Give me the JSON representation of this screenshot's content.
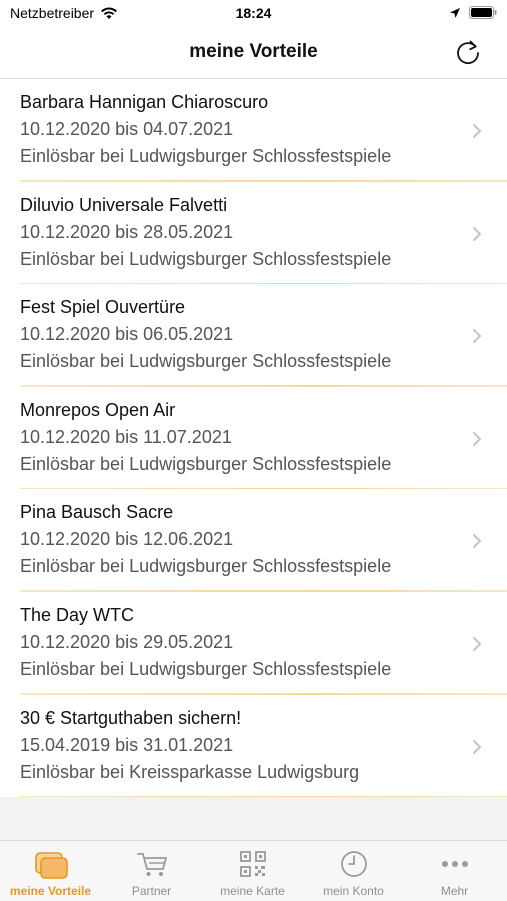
{
  "status_bar": {
    "carrier": "Netzbetreiber",
    "time": "18:24"
  },
  "header": {
    "title": "meine Vorteile"
  },
  "colors": {
    "accent": "#e39a1c",
    "separator": "#f2d99b",
    "inactive": "#8e8e8e"
  },
  "items": [
    {
      "title": "Barbara Hannigan Chiaroscuro",
      "dates": "10.12.2020 bis 04.07.2021",
      "redeem": "Einlösbar bei Ludwigsburger Schlossfestspiele"
    },
    {
      "title": "Diluvio Universale Falvetti",
      "dates": "10.12.2020 bis 28.05.2021",
      "redeem": "Einlösbar bei Ludwigsburger Schlossfestspiele"
    },
    {
      "title": "Fest Spiel Ouvertüre",
      "dates": "10.12.2020 bis 06.05.2021",
      "redeem": "Einlösbar bei Ludwigsburger Schlossfestspiele"
    },
    {
      "title": "Monrepos Open Air",
      "dates": "10.12.2020 bis 11.07.2021",
      "redeem": "Einlösbar bei Ludwigsburger Schlossfestspiele"
    },
    {
      "title": "Pina Bausch Sacre",
      "dates": "10.12.2020 bis 12.06.2021",
      "redeem": "Einlösbar bei Ludwigsburger Schlossfestspiele"
    },
    {
      "title": "The Day WTC",
      "dates": "10.12.2020 bis 29.05.2021",
      "redeem": "Einlösbar bei Ludwigsburger Schlossfestspiele"
    },
    {
      "title": "30 € Startguthaben sichern!",
      "dates": "15.04.2019 bis 31.01.2021",
      "redeem": "Einlösbar bei Kreissparkasse Ludwigsburg"
    }
  ],
  "tabs": [
    {
      "label": "meine Vorteile",
      "icon": "cards-icon",
      "active": true
    },
    {
      "label": "Partner",
      "icon": "cart-icon",
      "active": false
    },
    {
      "label": "meine Karte",
      "icon": "qr-code-icon",
      "active": false
    },
    {
      "label": "mein Konto",
      "icon": "clock-icon",
      "active": false
    },
    {
      "label": "Mehr",
      "icon": "more-dots-icon",
      "active": false
    }
  ]
}
